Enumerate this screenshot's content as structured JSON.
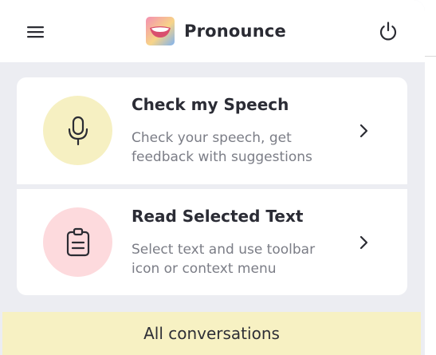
{
  "app": {
    "title": "Pronounce"
  },
  "header": {
    "menu_icon": "hamburger-menu-icon",
    "logo_icon": "smiling-mouth-logo",
    "power_icon": "power-icon"
  },
  "cards": [
    {
      "title": "Check my Speech",
      "description": "Check your speech, get feedback with suggestions",
      "icon": "microphone-icon",
      "icon_bg": "#f6f0c2"
    },
    {
      "title": "Read Selected Text",
      "description": "Select text and use toolbar icon or context menu",
      "icon": "clipboard-icon",
      "icon_bg": "#fddadd"
    }
  ],
  "footer": {
    "label": "All conversations",
    "bg": "#f7f1c3"
  }
}
